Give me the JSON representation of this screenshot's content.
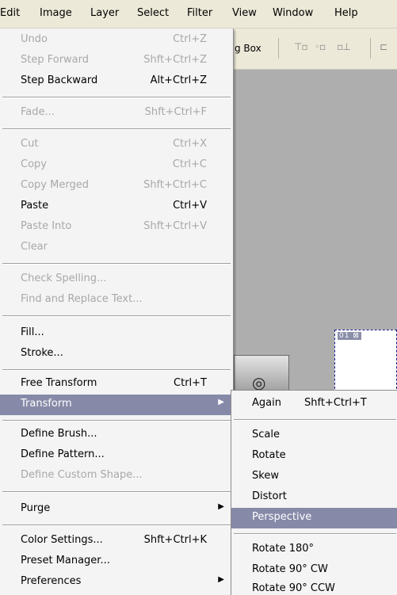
{
  "menubar": {
    "items": [
      "Edit",
      "Image",
      "Layer",
      "Select",
      "Filter",
      "View",
      "Window",
      "Help"
    ]
  },
  "options_bar": {
    "text": "g Box"
  },
  "document": {
    "title": "01 ⊠"
  },
  "edit_menu": {
    "undo": {
      "label": "Undo",
      "shortcut": "Ctrl+Z"
    },
    "step_forward": {
      "label": "Step Forward",
      "shortcut": "Shft+Ctrl+Z"
    },
    "step_backward": {
      "label": "Step Backward",
      "shortcut": "Alt+Ctrl+Z"
    },
    "fade": {
      "label": "Fade...",
      "shortcut": "Shft+Ctrl+F"
    },
    "cut": {
      "label": "Cut",
      "shortcut": "Ctrl+X"
    },
    "copy": {
      "label": "Copy",
      "shortcut": "Ctrl+C"
    },
    "copy_merged": {
      "label": "Copy Merged",
      "shortcut": "Shft+Ctrl+C"
    },
    "paste": {
      "label": "Paste",
      "shortcut": "Ctrl+V"
    },
    "paste_into": {
      "label": "Paste Into",
      "shortcut": "Shft+Ctrl+V"
    },
    "clear": {
      "label": "Clear"
    },
    "check_spelling": {
      "label": "Check Spelling..."
    },
    "find_replace": {
      "label": "Find and Replace Text..."
    },
    "fill": {
      "label": "Fill..."
    },
    "stroke": {
      "label": "Stroke..."
    },
    "free_transform": {
      "label": "Free Transform",
      "shortcut": "Ctrl+T"
    },
    "transform": {
      "label": "Transform"
    },
    "define_brush": {
      "label": "Define Brush..."
    },
    "define_pattern": {
      "label": "Define Pattern..."
    },
    "define_custom_shape": {
      "label": "Define Custom Shape..."
    },
    "purge": {
      "label": "Purge"
    },
    "color_settings": {
      "label": "Color Settings...",
      "shortcut": "Shft+Ctrl+K"
    },
    "preset_manager": {
      "label": "Preset Manager..."
    },
    "preferences": {
      "label": "Preferences"
    }
  },
  "transform_submenu": {
    "again": {
      "label": "Again",
      "shortcut": "Shft+Ctrl+T"
    },
    "scale": {
      "label": "Scale"
    },
    "rotate": {
      "label": "Rotate"
    },
    "skew": {
      "label": "Skew"
    },
    "distort": {
      "label": "Distort"
    },
    "perspective": {
      "label": "Perspective"
    },
    "rotate_180": {
      "label": "Rotate 180°"
    },
    "rotate_90_cw": {
      "label": "Rotate 90° CW"
    },
    "rotate_90_ccw": {
      "label": "Rotate 90° CCW"
    }
  },
  "colors": {
    "highlight": "#868aa8",
    "menu_bg": "#f4f4f4",
    "disabled_text": "#a8a8a8"
  },
  "icons": [
    "submenu-arrow-icon",
    "align-top-icon",
    "align-vcenter-icon",
    "align-bottom-icon"
  ]
}
